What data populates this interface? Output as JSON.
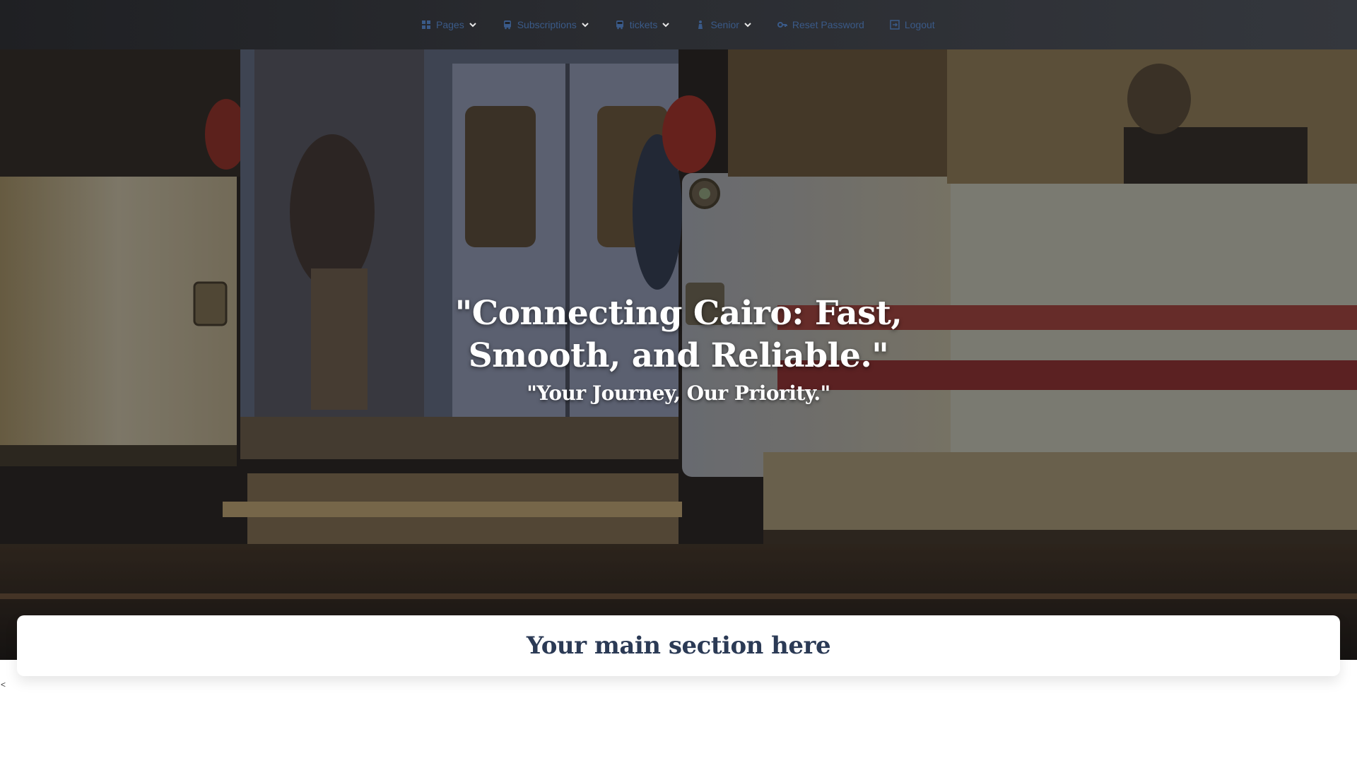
{
  "nav": {
    "items": [
      {
        "label": "Pages",
        "icon": "grid-icon",
        "dropdown": true
      },
      {
        "label": "Subscriptions",
        "icon": "bus-icon",
        "dropdown": true
      },
      {
        "label": "tickets",
        "icon": "bus-icon",
        "dropdown": true
      },
      {
        "label": "Senior",
        "icon": "person-icon",
        "dropdown": true
      },
      {
        "label": "Reset Password",
        "icon": "key-icon",
        "dropdown": false
      },
      {
        "label": "Logout",
        "icon": "logout-icon",
        "dropdown": false
      }
    ],
    "color": "#3a5a88"
  },
  "hero": {
    "title": "\"Connecting Cairo: Fast, Smooth, and Reliable.\"",
    "subtitle": "\"Your Journey, Our Priority.\""
  },
  "main": {
    "heading": "Your main section here"
  },
  "footer": {
    "stray_text": "<"
  }
}
